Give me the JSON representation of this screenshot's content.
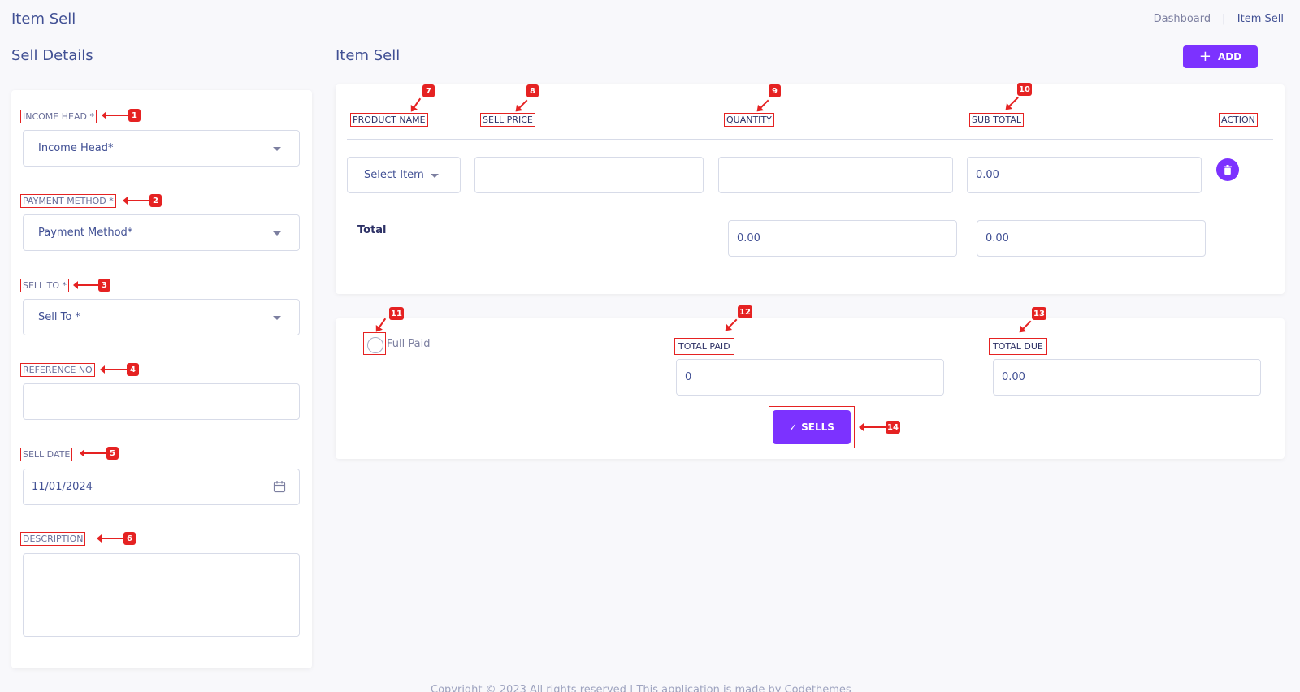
{
  "header": {
    "page_title": "Item Sell",
    "breadcrumb": {
      "home": "Dashboard",
      "separator": "|",
      "current": "Item Sell"
    }
  },
  "sell_details": {
    "title": "Sell Details",
    "income_head": {
      "label": "INCOME HEAD *",
      "value": "Income Head*",
      "badge": "1"
    },
    "payment_method": {
      "label": "PAYMENT METHOD *",
      "value": "Payment Method*",
      "badge": "2"
    },
    "sell_to": {
      "label": "SELL TO *",
      "value": "Sell To *",
      "badge": "3"
    },
    "reference_no": {
      "label": "REFERENCE NO",
      "value": "",
      "badge": "4"
    },
    "sell_date": {
      "label": "SELL DATE",
      "value": "11/01/2024",
      "badge": "5"
    },
    "description": {
      "label": "DESCRIPTION",
      "value": "",
      "badge": "6"
    }
  },
  "item_sell": {
    "title": "Item Sell",
    "add_button": "ADD",
    "columns": [
      {
        "label": "PRODUCT NAME",
        "badge": "7"
      },
      {
        "label": "SELL PRICE",
        "badge": "8"
      },
      {
        "label": "QUANTITY",
        "badge": "9"
      },
      {
        "label": "SUB TOTAL",
        "badge": "10"
      },
      {
        "label": "ACTION",
        "badge": ""
      }
    ],
    "row": {
      "product_select": "Select Item",
      "sell_price": "",
      "quantity": "",
      "sub_total": "0.00"
    },
    "total": {
      "label": "Total",
      "quantity_total": "0.00",
      "sub_total": "0.00"
    }
  },
  "payment": {
    "full_paid": {
      "label": "Full Paid",
      "badge": "11"
    },
    "total_paid": {
      "label": "TOTAL PAID",
      "value": "0",
      "badge": "12"
    },
    "total_due": {
      "label": "TOTAL DUE",
      "value": "0.00",
      "badge": "13"
    },
    "sells_button": {
      "label": "SELLS",
      "badge": "14"
    }
  },
  "footer": {
    "text": "Copyright © 2023 All rights reserved | This application is made by Codethemes"
  },
  "colors": {
    "accent": "#7c32ff",
    "text": "#415094",
    "annotation": "#e52222"
  }
}
